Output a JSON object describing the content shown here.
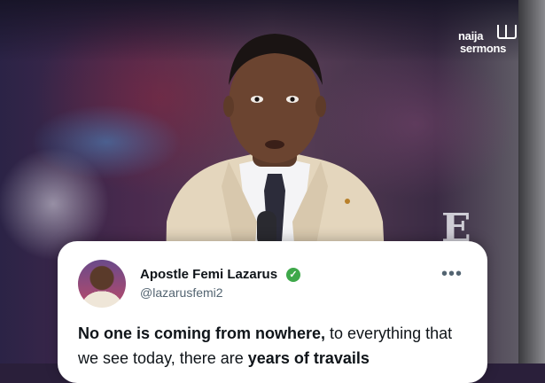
{
  "logo": {
    "line1": "naija",
    "line2": "sermons"
  },
  "backdrop": {
    "letter": "E"
  },
  "tweet": {
    "author_name": "Apostle Femi Lazarus",
    "handle": "@lazarusfemi2",
    "verified_color": "#3ea84a",
    "more_label": "•••",
    "text_bold_1": "No one is coming from nowhere,",
    "text_regular_1": " to everything that we see today, there are ",
    "text_bold_2": "years of travails"
  },
  "icons": [
    "verified-icon",
    "more-options-icon",
    "logo-book-icon"
  ]
}
